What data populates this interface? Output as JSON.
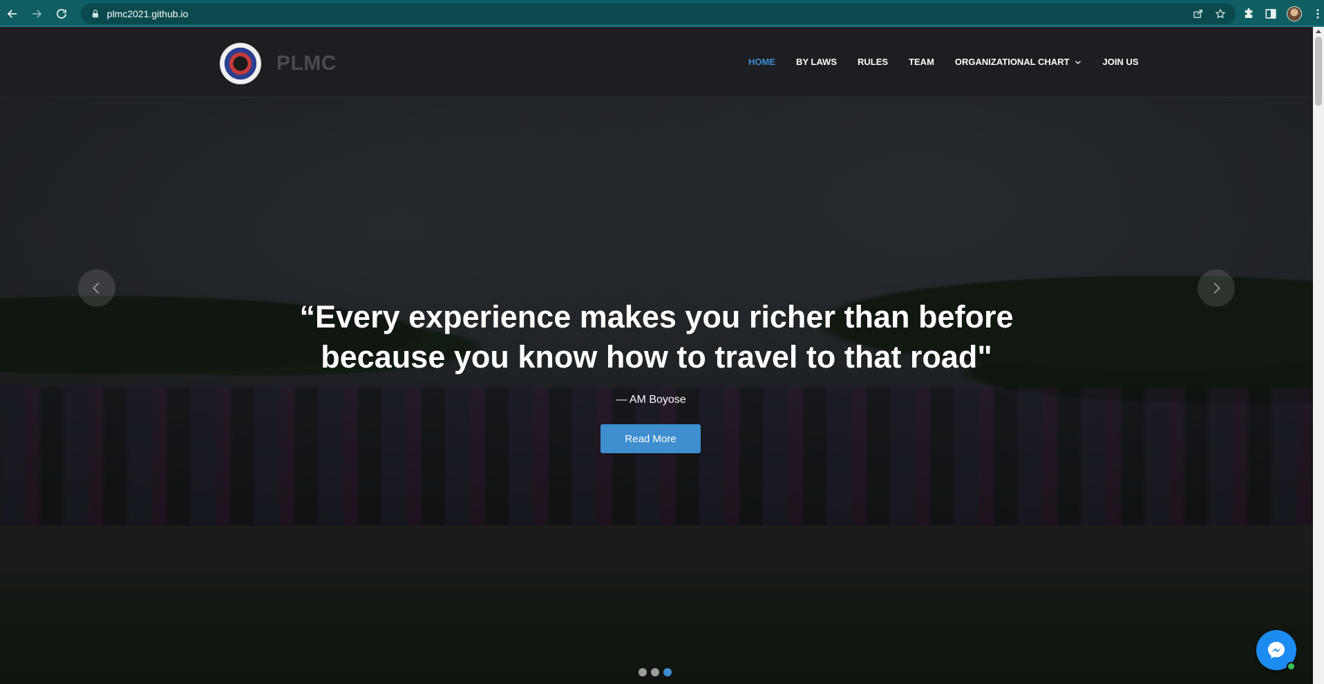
{
  "browser": {
    "url": "plmc2021.github.io",
    "back_icon": "arrow-left-icon",
    "forward_icon": "arrow-right-icon",
    "reload_icon": "reload-icon"
  },
  "header": {
    "brand": "PLMC",
    "nav": {
      "home": "HOME",
      "bylaws": "BY LAWS",
      "rules": "RULES",
      "team": "TEAM",
      "org_chart": "ORGANIZATIONAL CHART",
      "join": "JOIN US"
    },
    "active_item": "HOME"
  },
  "hero": {
    "quote_line1": "“Every experience makes you richer than before",
    "quote_line2": "because you know how to travel to that road\"",
    "author": "— AM Boyose",
    "cta": "Read More",
    "slides_total": 3,
    "active_slide": 3
  },
  "colors": {
    "accent": "#3e8ed0",
    "chrome": "#0e5e63",
    "header_bg": "#1d1e21",
    "messenger": "#1d8cf1"
  }
}
